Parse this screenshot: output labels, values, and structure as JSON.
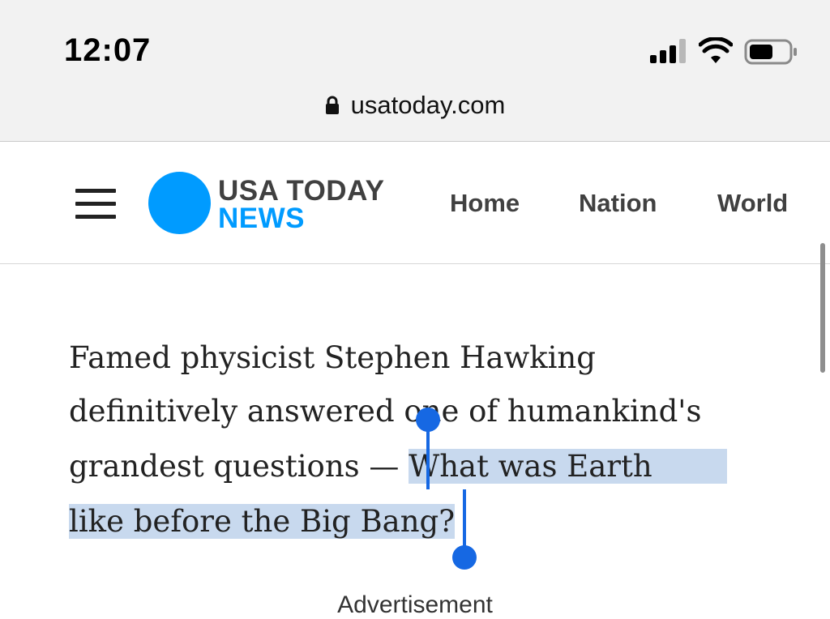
{
  "status_bar": {
    "time": "12:07",
    "icons": [
      "cellular-signal-icon",
      "wifi-icon",
      "battery-icon"
    ]
  },
  "browser": {
    "url": "usatoday.com",
    "lock_icon": "lock-icon"
  },
  "site_header": {
    "menu_icon": "hamburger-menu-icon",
    "logo_line1": "USA TODAY",
    "logo_line2": "NEWS",
    "brand_color": "#009bff",
    "nav": [
      "Home",
      "Nation",
      "World"
    ]
  },
  "article": {
    "line1": "Famed physicist Stephen Hawking",
    "line2": "definitively answered one of humankind's",
    "line3_plain": "grandest questions — ",
    "line3_selected": "What was Earth",
    "line4_selected": "like before the Big Bang?",
    "selection_color": "#c8d9ee",
    "handle_color": "#1668e3"
  },
  "ad_label": "Advertisement"
}
